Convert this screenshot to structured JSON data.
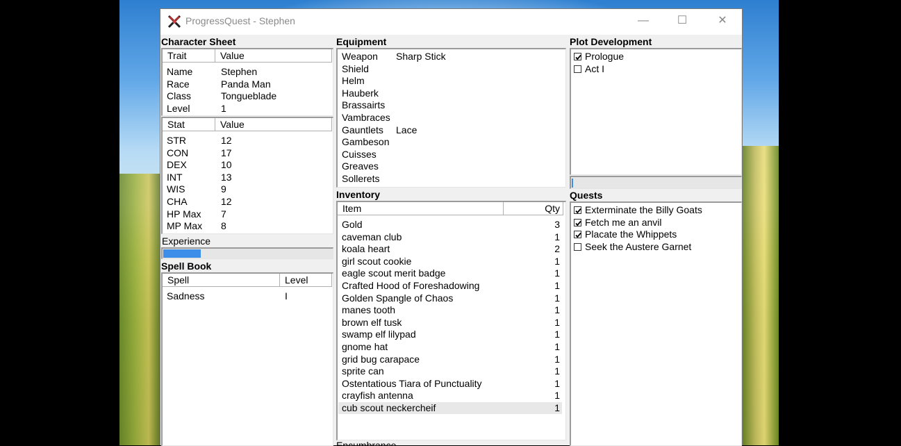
{
  "window": {
    "title": "ProgressQuest - Stephen",
    "minimize": "—",
    "maximize": "☐",
    "close": "✕"
  },
  "character_sheet": {
    "heading": "Character Sheet",
    "trait_col": "Trait",
    "value_col": "Value",
    "traits": [
      {
        "k": "Name",
        "v": "Stephen"
      },
      {
        "k": "Race",
        "v": "Panda Man"
      },
      {
        "k": "Class",
        "v": "Tongueblade"
      },
      {
        "k": "Level",
        "v": "1"
      }
    ],
    "stat_col": "Stat",
    "stat_value_col": "Value",
    "stats": [
      {
        "k": "STR",
        "v": "12"
      },
      {
        "k": "CON",
        "v": "17"
      },
      {
        "k": "DEX",
        "v": "10"
      },
      {
        "k": "INT",
        "v": "13"
      },
      {
        "k": "WIS",
        "v": "9"
      },
      {
        "k": "CHA",
        "v": "12"
      },
      {
        "k": "HP Max",
        "v": "7"
      },
      {
        "k": "MP Max",
        "v": "8"
      }
    ],
    "experience_label": "Experience",
    "experience_progress": 0.22
  },
  "spell_book": {
    "heading": "Spell Book",
    "spell_col": "Spell",
    "level_col": "Level",
    "spells": [
      {
        "name": "Sadness",
        "level": "I"
      }
    ]
  },
  "equipment": {
    "heading": "Equipment",
    "items": [
      {
        "slot": "Weapon",
        "item": "Sharp Stick"
      },
      {
        "slot": "Shield",
        "item": ""
      },
      {
        "slot": "Helm",
        "item": ""
      },
      {
        "slot": "Hauberk",
        "item": ""
      },
      {
        "slot": "Brassairts",
        "item": ""
      },
      {
        "slot": "Vambraces",
        "item": ""
      },
      {
        "slot": "Gauntlets",
        "item": "Lace"
      },
      {
        "slot": "Gambeson",
        "item": ""
      },
      {
        "slot": "Cuisses",
        "item": ""
      },
      {
        "slot": "Greaves",
        "item": ""
      },
      {
        "slot": "Sollerets",
        "item": ""
      }
    ]
  },
  "inventory": {
    "heading": "Inventory",
    "item_col": "Item",
    "qty_col": "Qty",
    "items": [
      {
        "name": "Gold",
        "qty": "3"
      },
      {
        "name": "caveman club",
        "qty": "1"
      },
      {
        "name": "koala heart",
        "qty": "2"
      },
      {
        "name": "girl scout cookie",
        "qty": "1"
      },
      {
        "name": "eagle scout merit badge",
        "qty": "1"
      },
      {
        "name": "Crafted Hood of Foreshadowing",
        "qty": "1"
      },
      {
        "name": "Golden Spangle of Chaos",
        "qty": "1"
      },
      {
        "name": "manes tooth",
        "qty": "1"
      },
      {
        "name": "brown elf tusk",
        "qty": "1"
      },
      {
        "name": "swamp elf lilypad",
        "qty": "1"
      },
      {
        "name": "gnome hat",
        "qty": "1"
      },
      {
        "name": "grid bug carapace",
        "qty": "1"
      },
      {
        "name": "sprite can",
        "qty": "1"
      },
      {
        "name": "Ostentatious Tiara of Punctuality",
        "qty": "1"
      },
      {
        "name": "crayfish antenna",
        "qty": "1"
      },
      {
        "name": "cub scout neckercheif",
        "qty": "1"
      }
    ],
    "footer_label": "Encumbrance"
  },
  "plot": {
    "heading": "Plot Development",
    "acts": [
      {
        "label": "Prologue",
        "checked": true
      },
      {
        "label": "Act I",
        "checked": false
      }
    ],
    "progress": 0.01
  },
  "quests": {
    "heading": "Quests",
    "items": [
      {
        "label": "Exterminate the Billy Goats",
        "checked": true
      },
      {
        "label": "Fetch me an anvil",
        "checked": true
      },
      {
        "label": "Placate the Whippets",
        "checked": true
      },
      {
        "label": "Seek the Austere Garnet",
        "checked": false
      }
    ]
  },
  "colors": {
    "progress_fill": "#3c8ee8",
    "window_bg": "#f0f0f0"
  }
}
